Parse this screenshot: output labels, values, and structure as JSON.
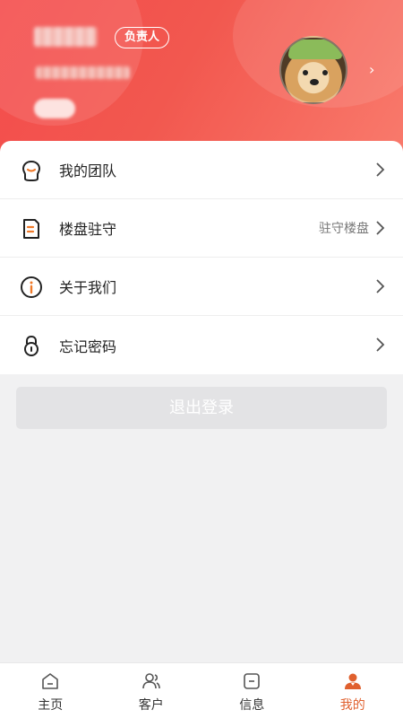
{
  "profile": {
    "role_badge": "负责人"
  },
  "menu": [
    {
      "label": "我的团队",
      "value": ""
    },
    {
      "label": "楼盘驻守",
      "value": "驻守楼盘"
    },
    {
      "label": "关于我们",
      "value": ""
    },
    {
      "label": "忘记密码",
      "value": ""
    }
  ],
  "logout_label": "退出登录",
  "tabs": [
    {
      "label": "主页",
      "icon": "home-icon"
    },
    {
      "label": "客户",
      "icon": "customers-icon"
    },
    {
      "label": "信息",
      "icon": "message-icon"
    },
    {
      "label": "我的",
      "icon": "profile-icon",
      "active": true
    }
  ],
  "colors": {
    "header_red": "#f44c4c",
    "active_tab": "#e0602e",
    "logout_bg": "#e3e3e5"
  }
}
